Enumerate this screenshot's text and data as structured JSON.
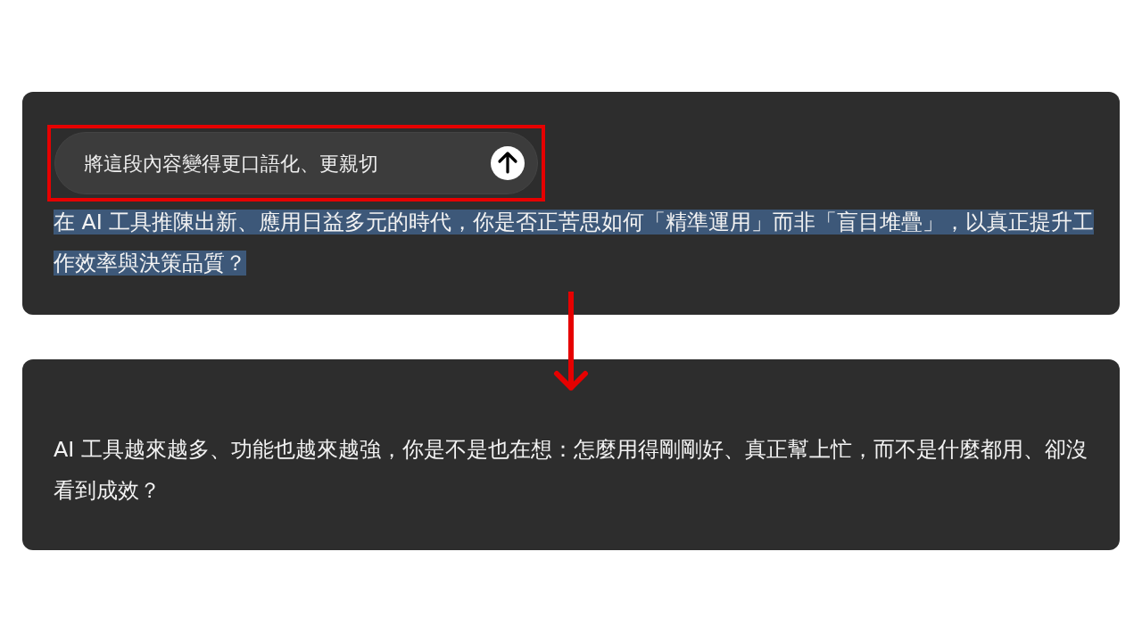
{
  "before_panel": {
    "prompt": {
      "text": "將這段內容變得更口語化、更親切",
      "annotated": true
    },
    "paragraph": {
      "text": "在 AI 工具推陳出新、應用日益多元的時代，你是否正苦思如何「精準運用」而非「盲目堆疊」，以真正提升工作效率與決策品質？",
      "selected": true
    }
  },
  "after_panel": {
    "paragraph": {
      "text": "AI 工具越來越多、功能也越來越強，你是不是也在想：怎麼用得剛剛好、真正幫上忙，而不是什麼都用、卻沒看到成效？",
      "selected": false
    }
  }
}
